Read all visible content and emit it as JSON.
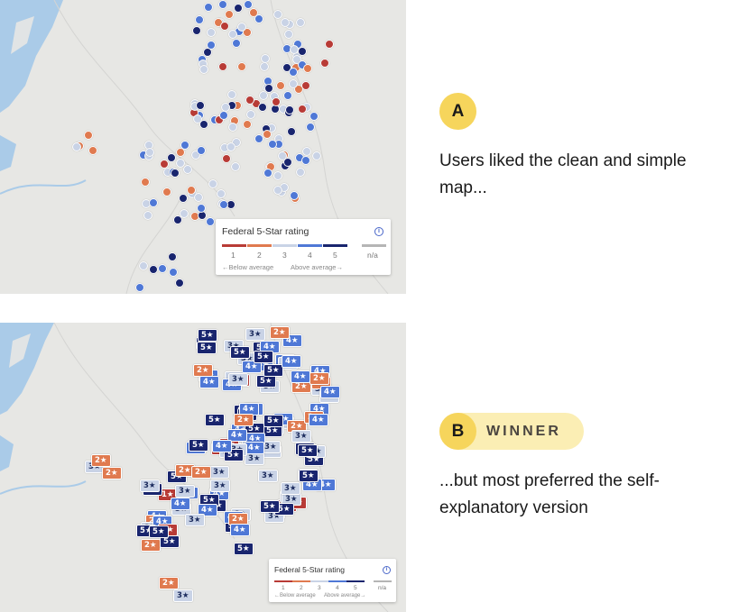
{
  "panel_a": {
    "badge_letter": "A",
    "caption": "Users liked the clean and simple map...",
    "legend": {
      "title": "Federal 5-Star rating",
      "info_icon": "info-icon",
      "scale": [
        "1",
        "2",
        "3",
        "4",
        "5"
      ],
      "na_label": "n/a",
      "below_label": "←Below average",
      "above_label": "Above average→"
    }
  },
  "panel_b": {
    "badge_letter": "B",
    "winner_label": "WINNER",
    "caption": "...but most preferred the self-explanatory version",
    "legend": {
      "title": "Federal 5-Star rating",
      "info_icon": "info-icon",
      "scale": [
        "1",
        "2",
        "3",
        "4",
        "5"
      ],
      "na_label": "n/a",
      "below_label": "←Below average",
      "above_label": "Above average→"
    }
  },
  "rating_colors": {
    "1": "#b83b36",
    "2": "#e07a4f",
    "3": "#c9d3e6",
    "4": "#4f78d6",
    "5": "#19256e",
    "na": "#b5b5b5"
  },
  "badge_color": "#f6d55c",
  "winner_pill_color": "#fbeeb4",
  "star_glyph": "★"
}
